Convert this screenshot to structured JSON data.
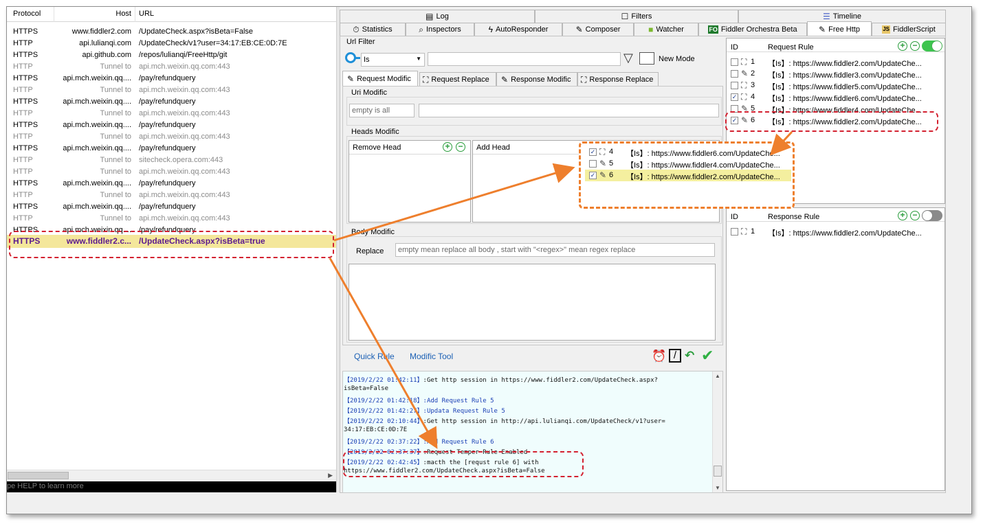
{
  "sessions": {
    "headers": {
      "protocol": "Protocol",
      "host": "Host",
      "url": "URL"
    },
    "rows": [
      {
        "protocol": "HTTPS",
        "host": "www.fiddler2.com",
        "url": "/UpdateCheck.aspx?isBeta=False",
        "tunnel": false
      },
      {
        "protocol": "HTTP",
        "host": "api.lulianqi.com",
        "url": "/UpdateCheck/v1?user=34:17:EB:CE:0D:7E",
        "tunnel": false
      },
      {
        "protocol": "HTTPS",
        "host": "api.github.com",
        "url": "/repos/lulianqi/FreeHttp/git",
        "tunnel": false
      },
      {
        "protocol": "HTTP",
        "host": "Tunnel to",
        "url": "api.mch.weixin.qq.com:443",
        "tunnel": true
      },
      {
        "protocol": "HTTPS",
        "host": "api.mch.weixin.qq....",
        "url": "/pay/refundquery",
        "tunnel": false
      },
      {
        "protocol": "HTTP",
        "host": "Tunnel to",
        "url": "api.mch.weixin.qq.com:443",
        "tunnel": true
      },
      {
        "protocol": "HTTPS",
        "host": "api.mch.weixin.qq....",
        "url": "/pay/refundquery",
        "tunnel": false
      },
      {
        "protocol": "HTTP",
        "host": "Tunnel to",
        "url": "api.mch.weixin.qq.com:443",
        "tunnel": true
      },
      {
        "protocol": "HTTPS",
        "host": "api.mch.weixin.qq....",
        "url": "/pay/refundquery",
        "tunnel": false
      },
      {
        "protocol": "HTTP",
        "host": "Tunnel to",
        "url": "api.mch.weixin.qq.com:443",
        "tunnel": true
      },
      {
        "protocol": "HTTPS",
        "host": "api.mch.weixin.qq....",
        "url": "/pay/refundquery",
        "tunnel": false
      },
      {
        "protocol": "HTTP",
        "host": "Tunnel to",
        "url": "sitecheck.opera.com:443",
        "tunnel": true
      },
      {
        "protocol": "HTTP",
        "host": "Tunnel to",
        "url": "api.mch.weixin.qq.com:443",
        "tunnel": true
      },
      {
        "protocol": "HTTPS",
        "host": "api.mch.weixin.qq....",
        "url": "/pay/refundquery",
        "tunnel": false
      },
      {
        "protocol": "HTTP",
        "host": "Tunnel to",
        "url": "api.mch.weixin.qq.com:443",
        "tunnel": true
      },
      {
        "protocol": "HTTPS",
        "host": "api.mch.weixin.qq....",
        "url": "/pay/refundquery",
        "tunnel": false
      },
      {
        "protocol": "HTTP",
        "host": "Tunnel to",
        "url": "api.mch.weixin.qq.com:443",
        "tunnel": true
      },
      {
        "protocol": "HTTPS",
        "host": "api.mch.weixin.qq....",
        "url": "/pay/refundquery",
        "tunnel": false
      }
    ],
    "selected": {
      "protocol": "HTTPS",
      "host": "www.fiddler2.c...",
      "url": "/UpdateCheck.aspx?isBeta=true"
    },
    "quickexec": "pe HELP to learn more"
  },
  "top_tabs": {
    "row1": [
      "Log",
      "Filters",
      "Timeline"
    ],
    "row2": [
      "Statistics",
      "Inspectors",
      "AutoResponder",
      "Composer",
      "Watcher",
      "Fiddler Orchestra Beta",
      "Free Http",
      "FiddlerScript"
    ],
    "fo_badge": "FO",
    "js_badge": "JS",
    "active": "Free Http"
  },
  "free_http": {
    "url_filter": {
      "label": "Url Filter",
      "match": "Is",
      "value": "",
      "new_mode": "New Mode"
    },
    "tabs": [
      "Request Modific",
      "Request Replace",
      "Response Modific",
      "Response Replace"
    ],
    "uri_modific": {
      "label": "Uri Modific",
      "placeholder": "empty is all",
      "value": ""
    },
    "heads_modific": {
      "label": "Heads Modific",
      "remove": "Remove Head",
      "add": "Add Head"
    },
    "body_modific": {
      "label": "Body Modific",
      "replace_label": "Replace",
      "placeholder": "empty mean replace all body , start with \"<regex>\" mean regex replace"
    },
    "bottom_links": {
      "quick_rule": "Quick Rule",
      "modific_tool": "Modific Tool"
    }
  },
  "request_rules": {
    "headers": {
      "id": "ID",
      "rule": "Request Rule"
    },
    "rows": [
      {
        "id": "1",
        "checked": false,
        "icon": "replace",
        "text": "【Is】: https://www.fiddler2.com/UpdateChe..."
      },
      {
        "id": "2",
        "checked": false,
        "icon": "edit",
        "text": "【Is】: https://www.fiddler3.com/UpdateChe..."
      },
      {
        "id": "3",
        "checked": false,
        "icon": "replace",
        "text": "【Is】: https://www.fiddler5.com/UpdateChe..."
      },
      {
        "id": "4",
        "checked": true,
        "icon": "replace",
        "text": "【Is】: https://www.fiddler6.com/UpdateChe..."
      },
      {
        "id": "5",
        "checked": false,
        "icon": "edit",
        "text": "【Is】: https://www.fiddler4.com/UpdateChe..."
      },
      {
        "id": "6",
        "checked": true,
        "icon": "edit",
        "text": "【Is】: https://www.fiddler2.com/UpdateChe..."
      }
    ]
  },
  "popup_rules": [
    {
      "id": "4",
      "checked": true,
      "icon": "replace",
      "text": "【Is】: https://www.fiddler6.com/UpdateChe..."
    },
    {
      "id": "5",
      "checked": false,
      "icon": "edit",
      "text": "【Is】: https://www.fiddler4.com/UpdateChe..."
    },
    {
      "id": "6",
      "checked": true,
      "icon": "edit",
      "text": "【Is】: https://www.fiddler2.com/UpdateChe...",
      "highlight": true
    }
  ],
  "response_rules": {
    "headers": {
      "id": "ID",
      "rule": "Response Rule"
    },
    "rows": [
      {
        "id": "1",
        "checked": false,
        "icon": "replace",
        "text": "【Is】: https://www.fiddler2.com/UpdateChe..."
      }
    ]
  },
  "log": [
    {
      "ts": "【2019/2/22 01:42:11】",
      "msg": ":Get http session in https://www.fiddler2.com/UpdateCheck.aspx?",
      "plain": true
    },
    {
      "ts": "",
      "msg": "isBeta=False",
      "plain": true
    },
    {
      "ts": "【2019/2/22 01:42:18】",
      "msg": ":Add Request Rule 5",
      "plain": false
    },
    {
      "ts": "【2019/2/22 01:42:27】",
      "msg": ":Updata Request Rule 5",
      "plain": false
    },
    {
      "ts": "【2019/2/22 02:10:44】",
      "msg": ":Get http session in http://api.lulianqi.com/UpdateCheck/v1?user=",
      "plain": true
    },
    {
      "ts": "",
      "msg": "34:17:EB:CE:0D:7E",
      "plain": true
    },
    {
      "ts": "【2019/2/22 02:37:22】",
      "msg": ":Add Request Rule 6",
      "plain": false
    },
    {
      "ts": "【2019/2/22 02:37:37】",
      "msg": ":Request Temper Rule Enabled",
      "plain": true
    },
    {
      "ts": "【2019/2/22 02:42:45】",
      "msg": ":macth the [requst rule 6] with",
      "plain": true
    },
    {
      "ts": "",
      "msg": "https://www.fiddler2.com/UpdateCheck.aspx?isBeta=False",
      "plain": true
    }
  ],
  "colors": {
    "accent_green": "#2a9d3c",
    "callout_red": "#d3202f",
    "arrow_orange": "#ee7f2d",
    "selected_row": "#f4e79b",
    "log_blue": "#1a3fb5"
  }
}
